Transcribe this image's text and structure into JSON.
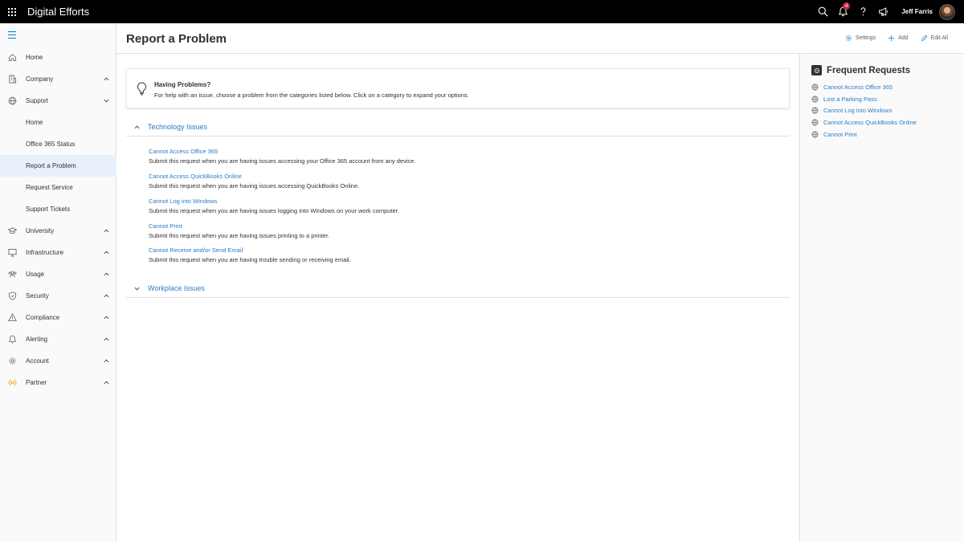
{
  "topbar": {
    "app_title": "Digital Efforts",
    "notification_count": "4",
    "user_name": "Jeff Farris"
  },
  "sidebar": {
    "items": [
      {
        "label": "Home"
      },
      {
        "label": "Company"
      },
      {
        "label": "Support"
      },
      {
        "label": "University"
      },
      {
        "label": "Infrastructure"
      },
      {
        "label": "Usage"
      },
      {
        "label": "Security"
      },
      {
        "label": "Compliance"
      },
      {
        "label": "Alerting"
      },
      {
        "label": "Account"
      },
      {
        "label": "Partner"
      }
    ],
    "support_sub": [
      {
        "label": "Home"
      },
      {
        "label": "Office 365 Status"
      },
      {
        "label": "Report a Problem"
      },
      {
        "label": "Request Service"
      },
      {
        "label": "Support Tickets"
      }
    ]
  },
  "header": {
    "title": "Report a Problem",
    "settings_label": "Settings",
    "add_label": "Add",
    "edit_all_label": "Edit All"
  },
  "info": {
    "title": "Having Problems?",
    "text": "For help with an issue, choose a problem from the categories listed below. Click on a category to expand your options."
  },
  "sections": [
    {
      "title": "Technology Issues"
    },
    {
      "title": "Workplace Issues"
    }
  ],
  "requests": [
    {
      "title": "Cannot Access Office 365",
      "desc": "Submit this request when you are having issues accessing your Office 365 account from any device."
    },
    {
      "title": "Cannot Access QuickBooks Online",
      "desc": "Submit this request when you are having issues accessing QuickBooks Online."
    },
    {
      "title": "Cannot Log into Windows",
      "desc": "Submit this request when you are having issues logging into Windows on your work computer."
    },
    {
      "title": "Cannot Print",
      "desc": "Submit this request when you are having issues printing to a printer."
    },
    {
      "title": "Cannot Receive and/or Send Email",
      "desc": "Submit this request when you are having trouble sending or receiving email."
    }
  ],
  "frequent": {
    "title": "Frequent Requests",
    "items": [
      {
        "label": "Cannot Access Office 365"
      },
      {
        "label": "Lost a Parking Pass"
      },
      {
        "label": "Cannot Log into Windows"
      },
      {
        "label": "Cannot Access QuickBooks Online"
      },
      {
        "label": "Cannot Print"
      }
    ]
  },
  "colors": {
    "accent": "#0078d4",
    "link": "#2b7bc4",
    "topbar": "#000000",
    "active_nav": "#e8f1fb",
    "partner_icon": "#f7a21b",
    "badge": "#c4314b"
  },
  "icons": {
    "topbar": [
      "waffle-icon",
      "search-icon",
      "bell-icon",
      "help-icon",
      "megaphone-icon"
    ],
    "sidebar": [
      "home-icon",
      "building-icon",
      "globe-icon",
      "graduation-cap-icon",
      "monitor-icon",
      "people-icon",
      "shield-icon",
      "warning-icon",
      "bell-icon",
      "gear-icon",
      "partner-icon"
    ],
    "header": [
      "gear-icon",
      "plus-icon",
      "pencil-icon"
    ],
    "info": "lightbulb-icon",
    "frequent": "globe-icon"
  }
}
